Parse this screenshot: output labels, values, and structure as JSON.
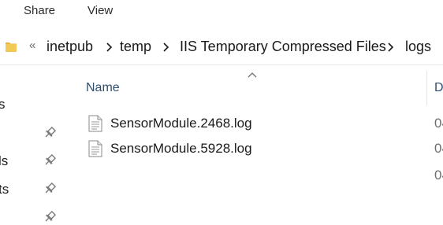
{
  "ribbon": {
    "tabs": [
      {
        "label": "Share"
      },
      {
        "label": "View"
      }
    ]
  },
  "address_bar": {
    "overflow_label": "«",
    "crumbs": [
      {
        "label": "inetpub"
      },
      {
        "label": "temp"
      },
      {
        "label": "IIS Temporary Compressed Files"
      },
      {
        "label": "logs"
      }
    ]
  },
  "nav_pane": {
    "items": [
      {
        "label": "s",
        "pinned": false
      },
      {
        "label": "",
        "pinned": true
      },
      {
        "label": "ls",
        "pinned": true
      },
      {
        "label": "ts",
        "pinned": true
      },
      {
        "label": "",
        "pinned": true
      }
    ]
  },
  "file_list": {
    "columns": {
      "name": "Name",
      "date": "D"
    },
    "sort": {
      "column": "name",
      "direction": "ascending"
    },
    "rows": [
      {
        "name": "SensorModule.2468.log",
        "date": "04"
      },
      {
        "name": "SensorModule.5928.log",
        "date": "04"
      }
    ],
    "extra_date": "04"
  },
  "colors": {
    "folder": "#e8b53c",
    "header_text": "#2f4f6f",
    "pin": "#7a7a7a"
  }
}
